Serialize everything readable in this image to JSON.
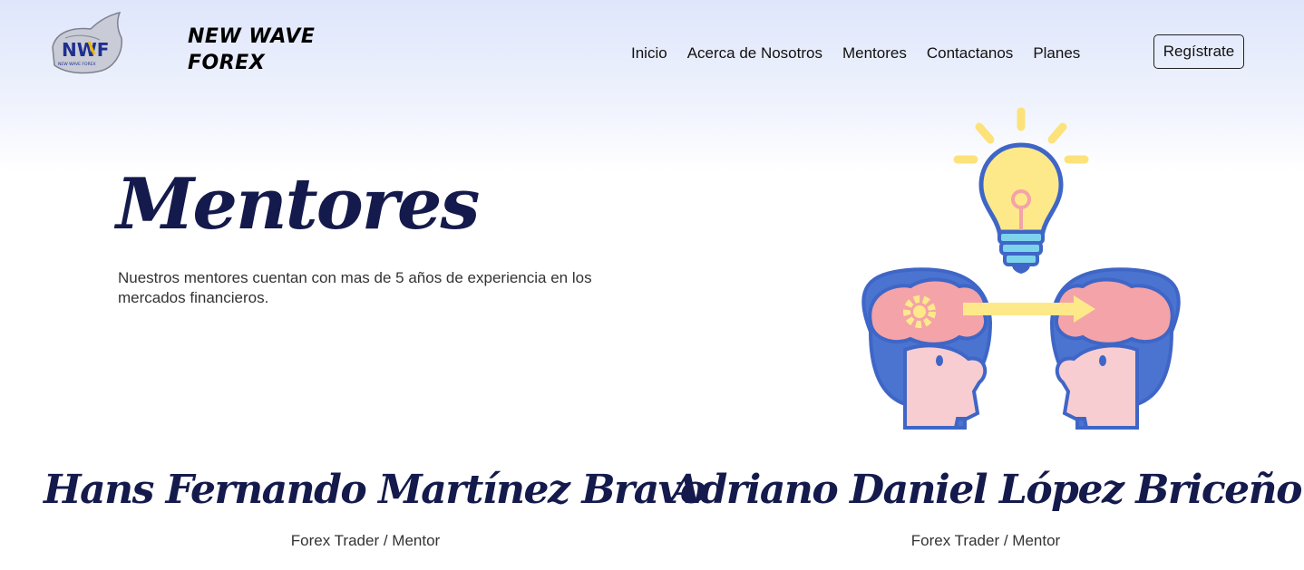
{
  "header": {
    "logo": {
      "icon": "nwf-logo-icon",
      "text": "NWF",
      "subtext": "NEW WAVE FOREX"
    },
    "brand_line1": "NEW WAVE",
    "brand_line2": "FOREX",
    "nav": [
      {
        "label": "Inicio"
      },
      {
        "label": "Acerca de Nosotros"
      },
      {
        "label": "Mentores"
      },
      {
        "label": "Contactanos"
      },
      {
        "label": "Planes"
      }
    ],
    "register_label": "Regístrate"
  },
  "hero": {
    "title": "Mentores",
    "description": "Nuestros mentores cuentan con mas de 5 años de experiencia en los mercados financieros.",
    "illustration": "idea-sharing-heads-lightbulb-icon"
  },
  "mentors": [
    {
      "name": "Hans Fernando Martínez Bravo",
      "role": "Forex Trader / Mentor"
    },
    {
      "name": "Adriano Daniel López Briceño",
      "role": "Forex Trader / Mentor"
    }
  ],
  "colors": {
    "navy": "#141a4c",
    "head_blue": "#4a74d0",
    "skin": "#f8cdd1",
    "brain": "#f4a3a8",
    "bulb": "#fde98a",
    "rays": "#fde27a",
    "bulb_base": "#7dd3ec"
  }
}
